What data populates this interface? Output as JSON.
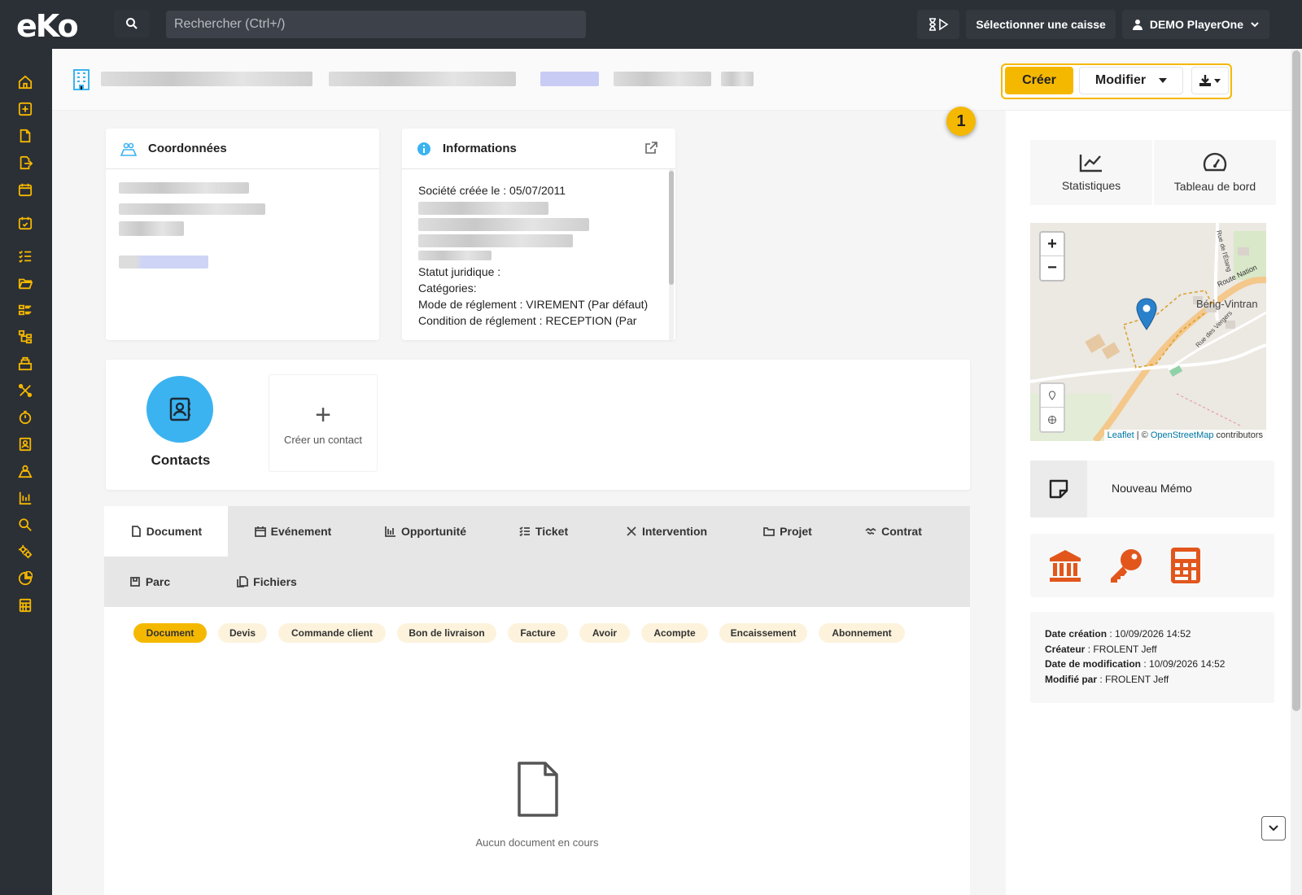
{
  "app": {
    "logo": "eKo"
  },
  "topbar": {
    "search_placeholder": "Rechercher (Ctrl+/)",
    "select_register": "Sélectionner une caisse",
    "user_name": "DEMO PlayerOne"
  },
  "header": {
    "create_label": "Créer",
    "modify_label": "Modifier",
    "step_badge": "1"
  },
  "coordonnees": {
    "title": "Coordonnées"
  },
  "informations": {
    "title": "Informations",
    "created_line": "Société créée le : 05/07/2011",
    "statut": "Statut juridique :",
    "categories": "Catégories:",
    "mode_reglement": "Mode de réglement : VIREMENT (Par défaut)",
    "condition_reglement": "Condition de réglement : RECEPTION (Par"
  },
  "contacts": {
    "label": "Contacts",
    "create_label": "Créer un contact"
  },
  "tabs": [
    {
      "label": "Document",
      "icon": "file-icon"
    },
    {
      "label": "Evénement",
      "icon": "calendar-icon"
    },
    {
      "label": "Opportunité",
      "icon": "bars-icon"
    },
    {
      "label": "Ticket",
      "icon": "checklist-icon"
    },
    {
      "label": "Intervention",
      "icon": "tools-icon"
    },
    {
      "label": "Projet",
      "icon": "folder-icon"
    },
    {
      "label": "Contrat",
      "icon": "handshake-icon"
    },
    {
      "label": "Parc",
      "icon": "box-icon"
    },
    {
      "label": "Fichiers",
      "icon": "files-icon"
    }
  ],
  "doc_filters": [
    "Document",
    "Devis",
    "Commande client",
    "Bon de livraison",
    "Facture",
    "Avoir",
    "Acompte",
    "Encaissement",
    "Abonnement"
  ],
  "empty_state": "Aucun document en cours",
  "right": {
    "stats_label": "Statistiques",
    "dashboard_label": "Tableau de bord",
    "map": {
      "zoom_in": "+",
      "zoom_out": "−",
      "place": "Bérig-Vintran",
      "road1": "Route Nation",
      "road2": "Rue de l'Étang",
      "road3": "Rue des Vergers",
      "attr_leaflet": "Leaflet",
      "attr_sep": " | © ",
      "attr_osm": "OpenStreetMap",
      "attr_rest": " contributors"
    },
    "memo_label": "Nouveau Mémo",
    "meta": {
      "created_key": "Date création",
      "created_val": " : 10/09/2026 14:52",
      "creator_key": "Créateur",
      "creator_val": " : FROLENT Jeff",
      "modified_key": "Date de modification",
      "modified_val": " : 10/09/2026 14:52",
      "modified_by_key": "Modifié par",
      "modified_by_val": " : FROLENT Jeff"
    }
  },
  "colors": {
    "accent": "#f5b800",
    "dark": "#2b2f36",
    "contact": "#3bb3f0",
    "tool": "#e2561c"
  }
}
